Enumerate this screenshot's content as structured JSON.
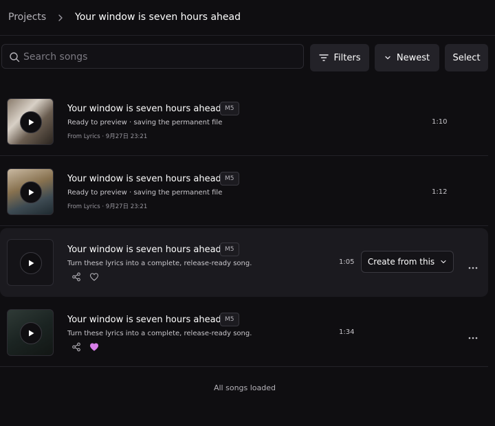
{
  "breadcrumb": {
    "root": "Projects",
    "current": "Your window is seven hours ahead"
  },
  "search": {
    "placeholder": "Search songs",
    "value": ""
  },
  "toolbar": {
    "filters_label": "Filters",
    "sort_label": "Newest",
    "select_label": "Select"
  },
  "songs": [
    {
      "title": "Your window is seven hours ahead",
      "badge": "M5",
      "subtitle": "Ready to preview · saving the permanent file",
      "meta": "From Lyrics · 9月27日 23:21",
      "duration": "1:10",
      "liked": false
    },
    {
      "title": "Your window is seven hours ahead",
      "badge": "M5",
      "subtitle": "Ready to preview · saving the permanent file",
      "meta": "From Lyrics · 9月27日 23:21",
      "duration": "1:12",
      "liked": false
    },
    {
      "title": "Your window is seven hours ahead",
      "badge": "M5",
      "subtitle": "Turn these lyrics into a complete, release-ready song.",
      "duration": "1:05",
      "create_label": "Create from this",
      "liked": false
    },
    {
      "title": "Your window is seven hours ahead",
      "badge": "M5",
      "subtitle": "Turn these lyrics into a complete, release-ready song.",
      "duration": "1:34",
      "liked": true
    }
  ],
  "footer": {
    "status": "All songs loaded"
  },
  "colors": {
    "background": "#0f0e11",
    "like_active": "#d77ee8",
    "active_row": "#1b1a1f"
  }
}
